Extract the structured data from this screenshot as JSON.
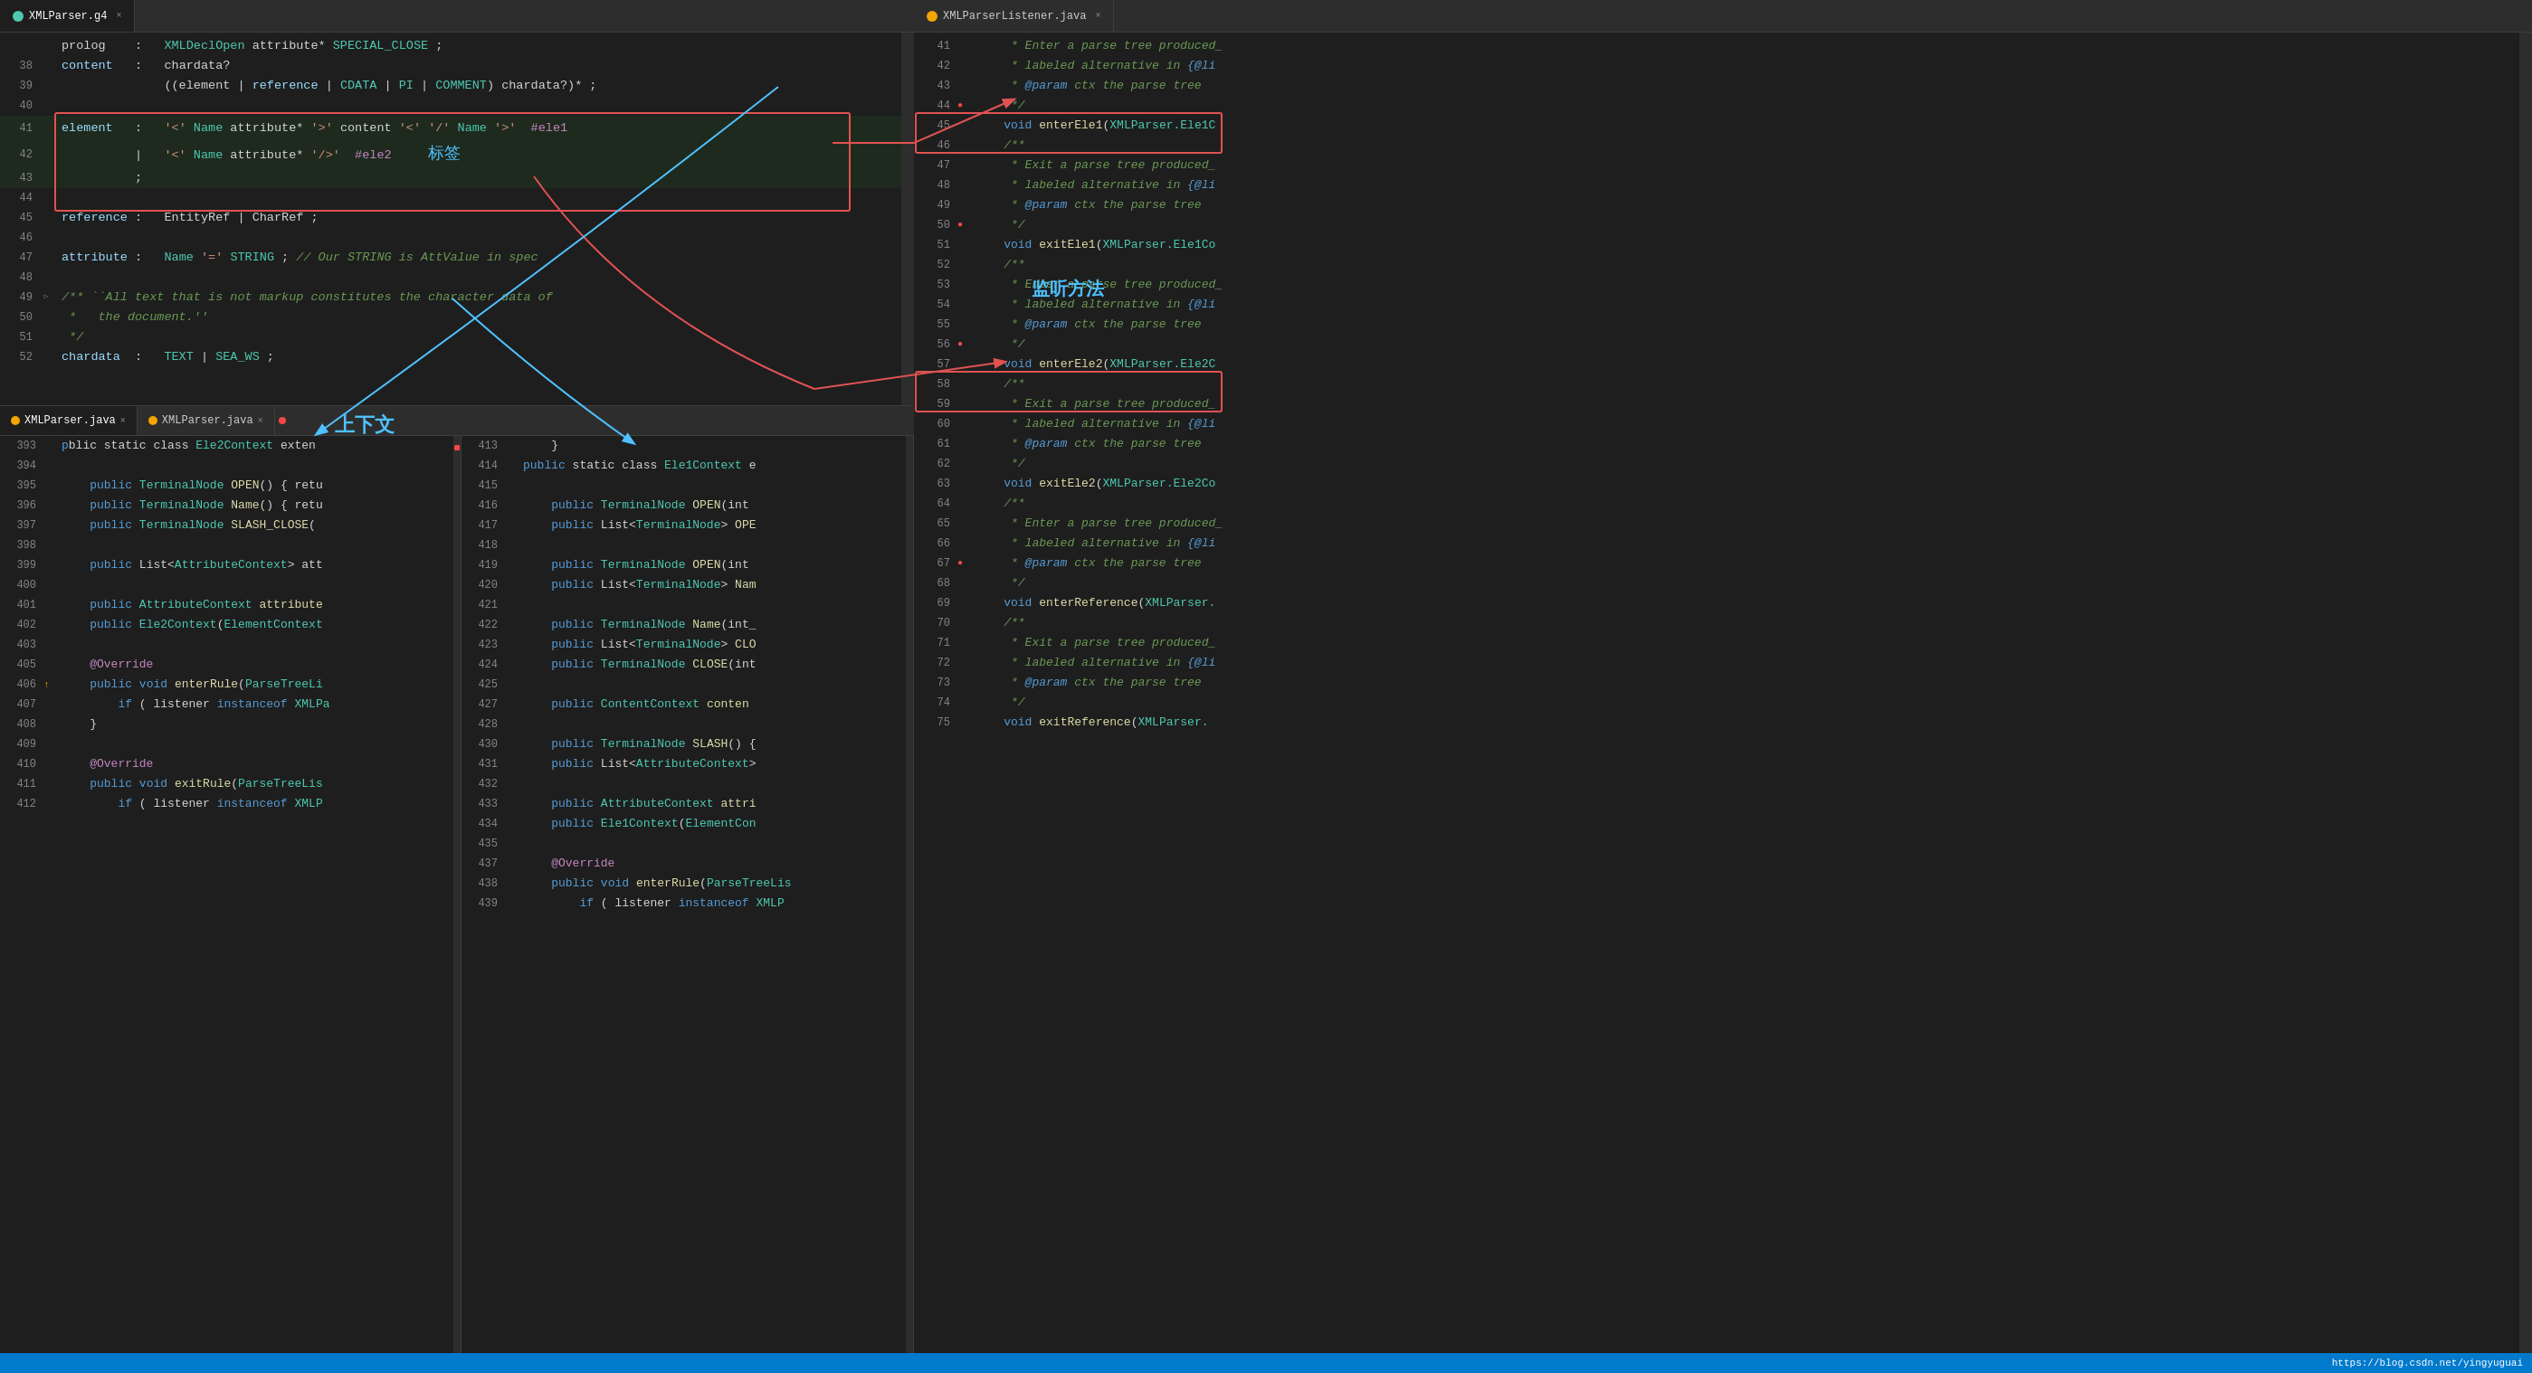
{
  "tabs": {
    "top_left": {
      "icon": "g4",
      "label": "XMLParser.g4",
      "active": true
    },
    "top_right": {
      "icon": "java",
      "label": "XMLParserListener.java",
      "active": false
    },
    "bottom_left1": {
      "icon": "java",
      "label": "XMLParser.java",
      "active": true
    },
    "bottom_left2": {
      "icon": "java",
      "label": "XMLParser.java",
      "active": false
    }
  },
  "grammar_lines": [
    {
      "num": "",
      "gutter": "",
      "content": "prolog    : XMLDeclOpen attribute* SPECIAL_CLOSE ;"
    },
    {
      "num": "38",
      "gutter": "",
      "content": "content   :   chardata?"
    },
    {
      "num": "39",
      "gutter": "",
      "content": "              ((element | reference | CDATA | PI | COMMENT) chardata?)* ;"
    },
    {
      "num": "40",
      "gutter": "",
      "content": ""
    },
    {
      "num": "41",
      "gutter": "",
      "content": "element   :   '<' Name attribute* '>' content '<' '/' Name '>'  #ele1"
    },
    {
      "num": "42",
      "gutter": "",
      "content": "          |   '<' Name attribute* '/>'  #ele2     标签"
    },
    {
      "num": "43",
      "gutter": "",
      "content": "          ;"
    },
    {
      "num": "44",
      "gutter": "",
      "content": ""
    },
    {
      "num": "45",
      "gutter": "",
      "content": "reference :   EntityRef | CharRef ;"
    },
    {
      "num": "46",
      "gutter": "",
      "content": ""
    },
    {
      "num": "47",
      "gutter": "",
      "content": "attribute :   Name '=' STRING ; // Our STRING is AttValue in spec"
    },
    {
      "num": "48",
      "gutter": "",
      "content": ""
    },
    {
      "num": "49",
      "gutter": "",
      "content": "/** ``All text that is not markup constitutes the character data of"
    },
    {
      "num": "50",
      "gutter": "",
      "content": " *   the document.''"
    },
    {
      "num": "51",
      "gutter": "",
      "content": " */"
    },
    {
      "num": "52",
      "gutter": "",
      "content": "chardata  :   TEXT | SEA_WS ;"
    }
  ],
  "right_lines": [
    {
      "num": "41",
      "gutter": "",
      "content": "     * Enter a parse tree produced_"
    },
    {
      "num": "42",
      "gutter": "",
      "content": "     * labeled alternative in {@li"
    },
    {
      "num": "43",
      "gutter": "",
      "content": "     * @param ctx the parse tree"
    },
    {
      "num": "44",
      "gutter": "●",
      "content": "     */"
    },
    {
      "num": "45",
      "gutter": "",
      "content": "    void enterEle1(XMLParser.Ele1C"
    },
    {
      "num": "46",
      "gutter": "",
      "content": "    /**"
    },
    {
      "num": "47",
      "gutter": "",
      "content": "     * Exit a parse tree produced_"
    },
    {
      "num": "48",
      "gutter": "",
      "content": "     * labeled alternative in {@li"
    },
    {
      "num": "49",
      "gutter": "",
      "content": "     * @param ctx the parse tree"
    },
    {
      "num": "50",
      "gutter": "●",
      "content": "     */"
    },
    {
      "num": "51",
      "gutter": "",
      "content": "    void exitEle1(XMLParser.Ele1Co"
    },
    {
      "num": "52",
      "gutter": "",
      "content": "    /**"
    },
    {
      "num": "53",
      "gutter": "",
      "content": "     * Enter a parse tree produced_"
    },
    {
      "num": "54",
      "gutter": "",
      "content": "     * labeled alternative in {@li"
    },
    {
      "num": "55",
      "gutter": "",
      "content": "     * @param ctx the parse tree"
    },
    {
      "num": "56",
      "gutter": "●",
      "content": "     */"
    },
    {
      "num": "57",
      "gutter": "",
      "content": "    void enterEle2(XMLParser.Ele2C"
    },
    {
      "num": "58",
      "gutter": "",
      "content": "    /**"
    },
    {
      "num": "59",
      "gutter": "",
      "content": "     * Exit a parse tree produced_"
    },
    {
      "num": "60",
      "gutter": "",
      "content": "     * labeled alternative in {@li"
    },
    {
      "num": "61",
      "gutter": "",
      "content": "     * @param ctx the parse tree"
    },
    {
      "num": "62",
      "gutter": "",
      "content": "     */"
    },
    {
      "num": "63",
      "gutter": "",
      "content": "    void exitEle2(XMLParser.Ele2Co"
    },
    {
      "num": "64",
      "gutter": "",
      "content": "    /**"
    },
    {
      "num": "65",
      "gutter": "",
      "content": "     * Enter a parse tree produced_"
    },
    {
      "num": "66",
      "gutter": "",
      "content": "     * labeled alternative in {@li"
    },
    {
      "num": "67",
      "gutter": "●",
      "content": "     * @param ctx the parse tree"
    },
    {
      "num": "68",
      "gutter": "",
      "content": "     */"
    },
    {
      "num": "69",
      "gutter": "",
      "content": "    void enterReference(XMLParser."
    },
    {
      "num": "70",
      "gutter": "",
      "content": "    /**"
    },
    {
      "num": "71",
      "gutter": "",
      "content": "     * Exit a parse tree produced_"
    },
    {
      "num": "72",
      "gutter": "",
      "content": "     * labeled alternative in {@li"
    },
    {
      "num": "73",
      "gutter": "",
      "content": "     * @param ctx the parse tree"
    },
    {
      "num": "74",
      "gutter": "",
      "content": "     */"
    },
    {
      "num": "75",
      "gutter": "",
      "content": "    void exitReference(XMLParser."
    }
  ],
  "bottom_left_lines": [
    {
      "num": "393",
      "gutter": "",
      "content": "blic static class Ele2Context exten"
    },
    {
      "num": "394",
      "gutter": "",
      "content": ""
    },
    {
      "num": "395",
      "gutter": "",
      "content": "    public TerminalNode OPEN() { retu"
    },
    {
      "num": "396",
      "gutter": "",
      "content": "    public TerminalNode Name() { retu"
    },
    {
      "num": "397",
      "gutter": "",
      "content": "    public TerminalNode SLASH_CLOSE("
    },
    {
      "num": "398",
      "gutter": "",
      "content": ""
    },
    {
      "num": "399",
      "gutter": "",
      "content": "    public List<AttributeContext> att"
    },
    {
      "num": "400",
      "gutter": "",
      "content": ""
    },
    {
      "num": "401",
      "gutter": "",
      "content": "    public AttributeContext attribute"
    },
    {
      "num": "402",
      "gutter": "",
      "content": "    public Ele2Context(ElementContext"
    },
    {
      "num": "403",
      "gutter": "",
      "content": ""
    },
    {
      "num": "405",
      "gutter": "",
      "content": "    @Override"
    },
    {
      "num": "406",
      "gutter": "↑",
      "content": "    public void enterRule(ParseTreeLi"
    },
    {
      "num": "407",
      "gutter": "",
      "content": "        if ( listener instanceof XMLPa"
    },
    {
      "num": "408",
      "gutter": "",
      "content": "    }"
    },
    {
      "num": "409",
      "gutter": "",
      "content": ""
    },
    {
      "num": "410",
      "gutter": "",
      "content": "    @Override"
    },
    {
      "num": "411",
      "gutter": "",
      "content": "    public void exitRule(ParseTreeLis"
    },
    {
      "num": "412",
      "gutter": "",
      "content": "        if ( listener instanceof XMLP"
    }
  ],
  "bottom_right_lines": [
    {
      "num": "413",
      "gutter": "",
      "content": "    }"
    },
    {
      "num": "414",
      "gutter": "",
      "content": "public static class Ele1Context e"
    },
    {
      "num": "415",
      "gutter": "",
      "content": ""
    },
    {
      "num": "416",
      "gutter": "",
      "content": "    public TerminalNode OPEN(int"
    },
    {
      "num": "417",
      "gutter": "",
      "content": "    public List<TerminalNode> OPE"
    },
    {
      "num": "418",
      "gutter": "",
      "content": ""
    },
    {
      "num": "419",
      "gutter": "",
      "content": "    public TerminalNode OPEN(int"
    },
    {
      "num": "420",
      "gutter": "",
      "content": "    public List<TerminalNode> Nam"
    },
    {
      "num": "421",
      "gutter": "",
      "content": ""
    },
    {
      "num": "422",
      "gutter": "",
      "content": "    public TerminalNode Name(int_"
    },
    {
      "num": "423",
      "gutter": "",
      "content": "    public List<TerminalNode> CLO"
    },
    {
      "num": "424",
      "gutter": "",
      "content": "    public TerminalNode CLOSE(int"
    },
    {
      "num": "425",
      "gutter": "",
      "content": ""
    },
    {
      "num": "427",
      "gutter": "",
      "content": "    public ContentContext conten"
    },
    {
      "num": "428",
      "gutter": "",
      "content": ""
    },
    {
      "num": "430",
      "gutter": "",
      "content": "    public TerminalNode SLASH() {"
    },
    {
      "num": "431",
      "gutter": "",
      "content": "    public List<AttributeContext>"
    },
    {
      "num": "432",
      "gutter": "",
      "content": ""
    },
    {
      "num": "433",
      "gutter": "",
      "content": "    public AttributeContext attri"
    },
    {
      "num": "434",
      "gutter": "",
      "content": "    public Ele1Context(ElementCon"
    },
    {
      "num": "435",
      "gutter": "",
      "content": ""
    },
    {
      "num": "437",
      "gutter": "",
      "content": "    @Override"
    },
    {
      "num": "438",
      "gutter": "",
      "content": "    public void enterRule(ParseTreeLis"
    },
    {
      "num": "439",
      "gutter": "",
      "content": "        if ( listener instanceof XMLP"
    }
  ],
  "annotations": {
    "reference_label": "reference",
    "comment_label": "COMMENT )",
    "annotation_shang_xia_wen": "上下文",
    "annotation_biao_qian": "标签",
    "annotation_jian_ting": "监听方法"
  },
  "status_bar": {
    "url": "https://blog.csdn.net/yingyuguai"
  }
}
